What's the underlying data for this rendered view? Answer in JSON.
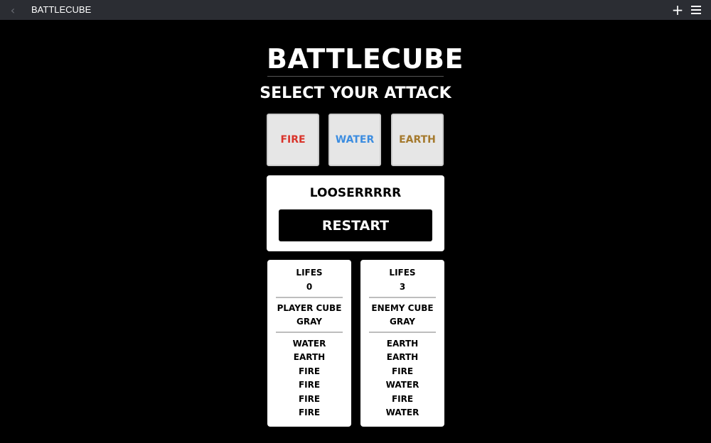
{
  "window": {
    "title": "BATTLECUBE",
    "back_icon": "chevron-left-icon",
    "add_icon": "plus-icon",
    "menu_icon": "hamburger-menu-icon"
  },
  "header": {
    "title": "BATTLECUBE",
    "subtitle": "SELECT YOUR ATTACK"
  },
  "attacks": [
    {
      "label": "FIRE",
      "color": "#d9342b"
    },
    {
      "label": "WATER",
      "color": "#3d8de0"
    },
    {
      "label": "EARTH",
      "color": "#a57a2e"
    }
  ],
  "result": {
    "message": "LOOSERRRRR",
    "restart_label": "RESTART"
  },
  "player": {
    "lifes_label": "LIFES",
    "lifes_value": "0",
    "name": "PLAYER CUBE",
    "color": "GRAY",
    "history": [
      "WATER",
      "EARTH",
      "FIRE",
      "FIRE",
      "FIRE",
      "FIRE"
    ]
  },
  "enemy": {
    "lifes_label": "LIFES",
    "lifes_value": "3",
    "name": "ENEMY CUBE",
    "color": "GRAY",
    "history": [
      "EARTH",
      "EARTH",
      "FIRE",
      "WATER",
      "FIRE",
      "WATER"
    ]
  }
}
